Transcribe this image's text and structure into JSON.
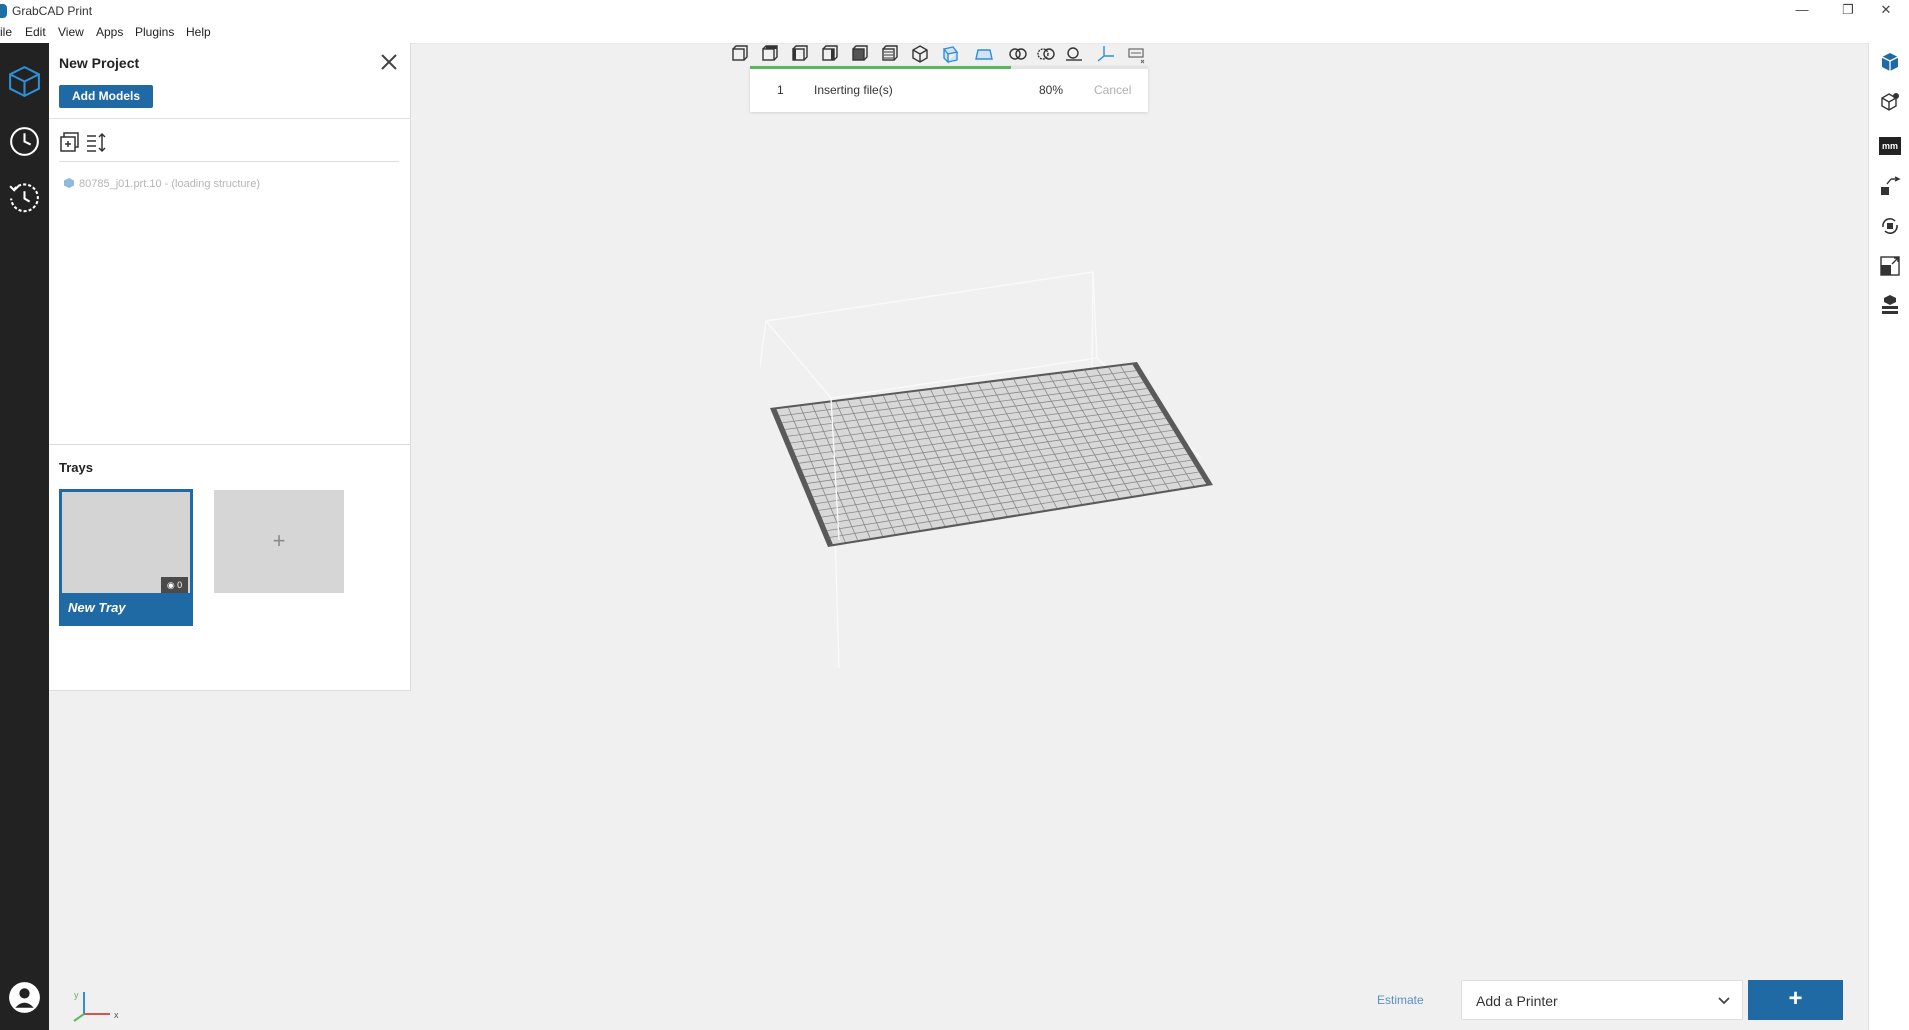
{
  "titlebar": {
    "title": "GrabCAD Print",
    "minimize_glyph": "—",
    "restore_glyph": "❐",
    "close_glyph": "✕"
  },
  "menu": {
    "items": [
      "ile",
      "Edit",
      "View",
      "Apps",
      "Plugins",
      "Help"
    ]
  },
  "left_rail": {
    "icons": [
      "cube-outline-icon",
      "clock-icon",
      "history-icon",
      "user-icon"
    ],
    "active_color": "#1f6aa5"
  },
  "project_panel": {
    "title": "New Project",
    "add_models_label": "Add Models",
    "model_entry": "80785_j01.prt.10 - (loading structure)",
    "trays_title": "Trays",
    "tray": {
      "name": "New Tray",
      "model_count": "0"
    },
    "add_tray_glyph": "+"
  },
  "progress": {
    "count": "1",
    "label": "Inserting file(s)",
    "percent_text": "80%",
    "percent_value": 80,
    "cancel_label": "Cancel"
  },
  "bottom": {
    "estimate_label": "Estimate",
    "printer_placeholder": "Add a Printer",
    "add_button_glyph": "+"
  },
  "right_rail": {
    "mm_label": "mm"
  },
  "colors": {
    "accent": "#1f6aa5",
    "progress_fill": "#5bb75b",
    "rail_dark": "#222223"
  }
}
